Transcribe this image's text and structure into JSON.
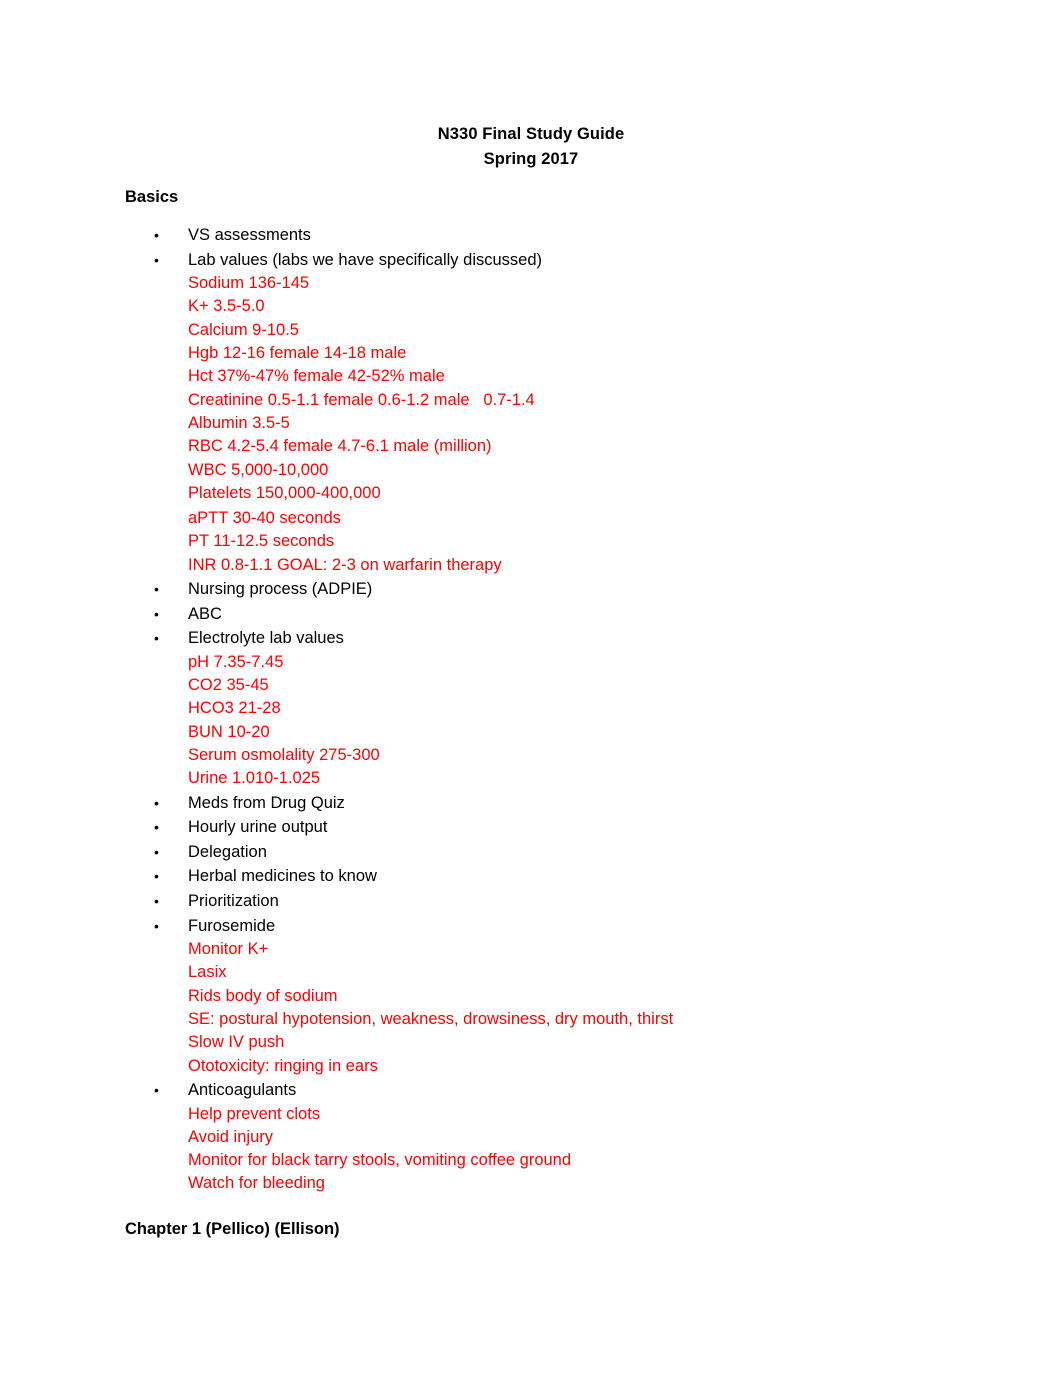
{
  "document": {
    "title_lines": [
      "N330 Final Study Guide",
      "Spring 2017"
    ],
    "section_heading": "Basics",
    "chapter_heading": "Chapter 1 (Pellico) (Ellison)",
    "colors": {
      "text": "#000000",
      "detail": "#FF0000",
      "background": "#FFFFFF"
    },
    "bullet_glyph": "•",
    "items": [
      {
        "label": "VS assessments",
        "details": []
      },
      {
        "label": "Lab values (labs we have specifically discussed)",
        "details": [
          "Sodium 136-145",
          "K+ 3.5-5.0",
          "Calcium 9-10.5",
          "Hgb 12-16 female 14-18 male",
          "Hct 37%-47% female 42-52% male",
          "Creatinine 0.5-1.1 female 0.6-1.2 male   0.7-1.4",
          "Albumin 3.5-5",
          "RBC 4.2-5.4 female 4.7-6.1 male (million)",
          "WBC 5,000-10,000",
          "Platelets 150,000-400,000",
          "aPTT 30-40 seconds",
          "PT 11-12.5 seconds",
          "INR 0.8-1.1 GOAL: 2-3 on warfarin therapy"
        ],
        "detail_gap_before_index": 10
      },
      {
        "label": "Nursing process (ADPIE)",
        "details": []
      },
      {
        "label": "ABC",
        "details": []
      },
      {
        "label": "Electrolyte lab values",
        "details": [
          "pH 7.35-7.45",
          "CO2 35-45",
          "HCO3 21-28",
          "BUN 10-20",
          "Serum osmolality 275-300",
          "Urine 1.010-1.025"
        ]
      },
      {
        "label": "Meds from Drug Quiz",
        "details": []
      },
      {
        "label": "Hourly urine output",
        "details": []
      },
      {
        "label": "Delegation",
        "details": []
      },
      {
        "label": "Herbal medicines to know",
        "details": []
      },
      {
        "label": "Prioritization",
        "details": []
      },
      {
        "label": "Furosemide",
        "details": [
          "Monitor K+",
          "Lasix",
          "Rids body of sodium",
          "SE: postural hypotension, weakness, drowsiness, dry mouth, thirst",
          "Slow IV push",
          "Ototoxicity: ringing in ears"
        ]
      },
      {
        "label": "Anticoagulants",
        "details": [
          "Help prevent clots",
          "Avoid injury",
          "Monitor for black tarry stools, vomiting coffee ground",
          "Watch for bleeding"
        ]
      }
    ]
  }
}
